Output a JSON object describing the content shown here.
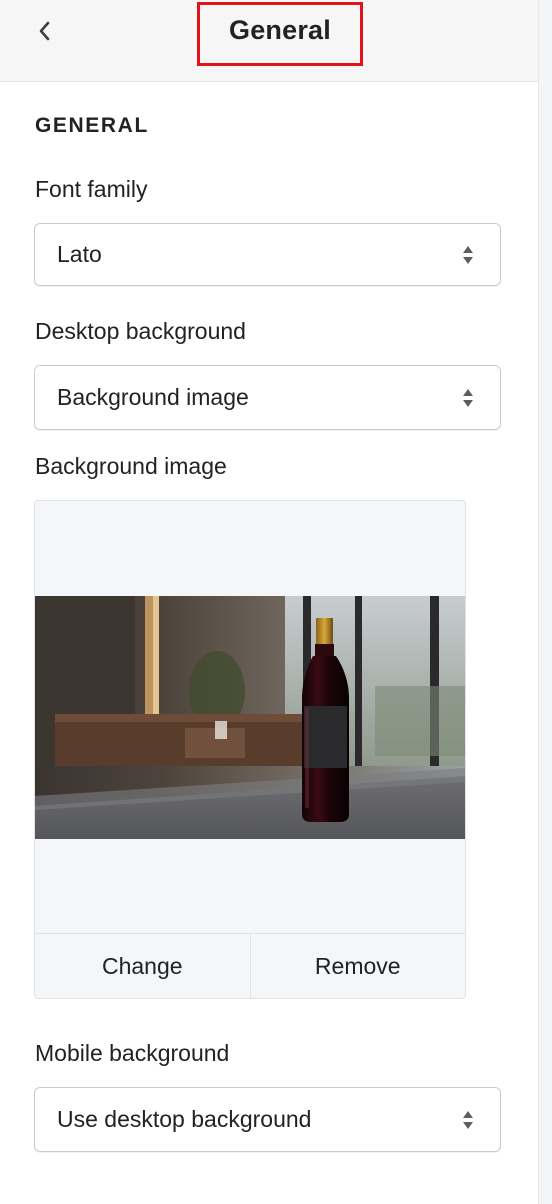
{
  "header": {
    "title": "General",
    "back_icon": "chevron-left-icon",
    "highlight_color": "#e0141b"
  },
  "section": {
    "heading": "GENERAL"
  },
  "font_family": {
    "label": "Font family",
    "value": "Lato"
  },
  "desktop_background": {
    "label": "Desktop background",
    "value": "Background image"
  },
  "background_image": {
    "label": "Background image",
    "preview_description_icon": "image-preview",
    "change_label": "Change",
    "remove_label": "Remove"
  },
  "mobile_background": {
    "label": "Mobile background",
    "value": "Use desktop background"
  }
}
